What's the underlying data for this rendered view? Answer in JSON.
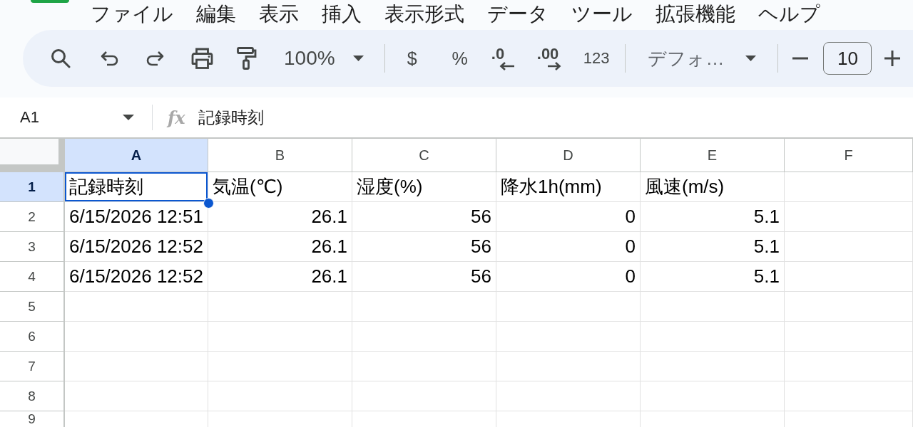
{
  "menu": [
    "ファイル",
    "編集",
    "表示",
    "挿入",
    "表示形式",
    "データ",
    "ツール",
    "拡張機能",
    "ヘルプ"
  ],
  "toolbar": {
    "zoom": "100%",
    "currency": "$",
    "percent": "%",
    "decrease_decimal": ".0",
    "increase_decimal": ".00",
    "number_format": "123",
    "font": "デフォ…",
    "font_size": "10"
  },
  "formula_bar": {
    "name_box": "A1",
    "fx": "fx",
    "formula": "記録時刻"
  },
  "columns": [
    {
      "label": "A",
      "selected": true
    },
    {
      "label": "B",
      "selected": false
    },
    {
      "label": "C",
      "selected": false
    },
    {
      "label": "D",
      "selected": false
    },
    {
      "label": "E",
      "selected": false
    },
    {
      "label": "F",
      "selected": false
    }
  ],
  "rows": [
    {
      "label": "1",
      "selected": true,
      "cells": [
        {
          "text": "記録時刻",
          "kind": "text"
        },
        {
          "text": "気温(℃)",
          "kind": "text"
        },
        {
          "text": "湿度(%)",
          "kind": "text"
        },
        {
          "text": "降水1h(mm)",
          "kind": "text"
        },
        {
          "text": "風速(m/s)",
          "kind": "text"
        }
      ]
    },
    {
      "label": "2",
      "selected": false,
      "cells": [
        {
          "text": "6/15/2026 12:51",
          "kind": "date"
        },
        {
          "text": "26.1",
          "kind": "number"
        },
        {
          "text": "56",
          "kind": "number"
        },
        {
          "text": "0",
          "kind": "number"
        },
        {
          "text": "5.1",
          "kind": "number"
        }
      ]
    },
    {
      "label": "3",
      "selected": false,
      "cells": [
        {
          "text": "6/15/2026 12:52",
          "kind": "date"
        },
        {
          "text": "26.1",
          "kind": "number"
        },
        {
          "text": "56",
          "kind": "number"
        },
        {
          "text": "0",
          "kind": "number"
        },
        {
          "text": "5.1",
          "kind": "number"
        }
      ]
    },
    {
      "label": "4",
      "selected": false,
      "cells": [
        {
          "text": "6/15/2026 12:52",
          "kind": "date"
        },
        {
          "text": "26.1",
          "kind": "number"
        },
        {
          "text": "56",
          "kind": "number"
        },
        {
          "text": "0",
          "kind": "number"
        },
        {
          "text": "5.1",
          "kind": "number"
        }
      ]
    },
    {
      "label": "5",
      "selected": false
    },
    {
      "label": "6",
      "selected": false
    },
    {
      "label": "7",
      "selected": false
    },
    {
      "label": "8",
      "selected": false
    },
    {
      "label": "9",
      "selected": false
    }
  ]
}
